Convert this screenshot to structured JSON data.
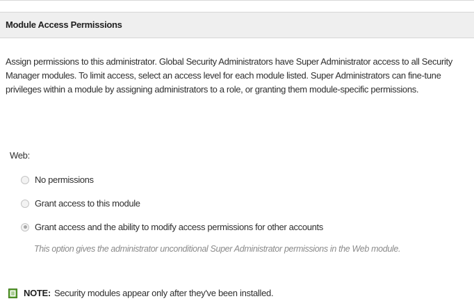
{
  "panel": {
    "title": "Module Access Permissions"
  },
  "description": "Assign permissions to this administrator. Global Security Administrators have Super Administrator access to all Security Manager modules. To limit access, select an access level for each module listed. Super Administrators can fine-tune privileges within a module by assigning administrators to a role, or granting them module-specific permissions.",
  "web": {
    "label": "Web:",
    "options": [
      {
        "label": "No permissions",
        "selected": false
      },
      {
        "label": "Grant access to this module",
        "selected": false
      },
      {
        "label": "Grant access and the ability to modify access permissions for other accounts",
        "selected": true
      }
    ],
    "help_text": "This option gives the administrator unconditional Super Administrator permissions in the Web module."
  },
  "note": {
    "label": "NOTE:",
    "text": "Security modules appear only after they've been installed.",
    "icon": "note-icon"
  },
  "colors": {
    "header_bg": "#efefef",
    "note_icon_green": "#5a9e2f"
  }
}
